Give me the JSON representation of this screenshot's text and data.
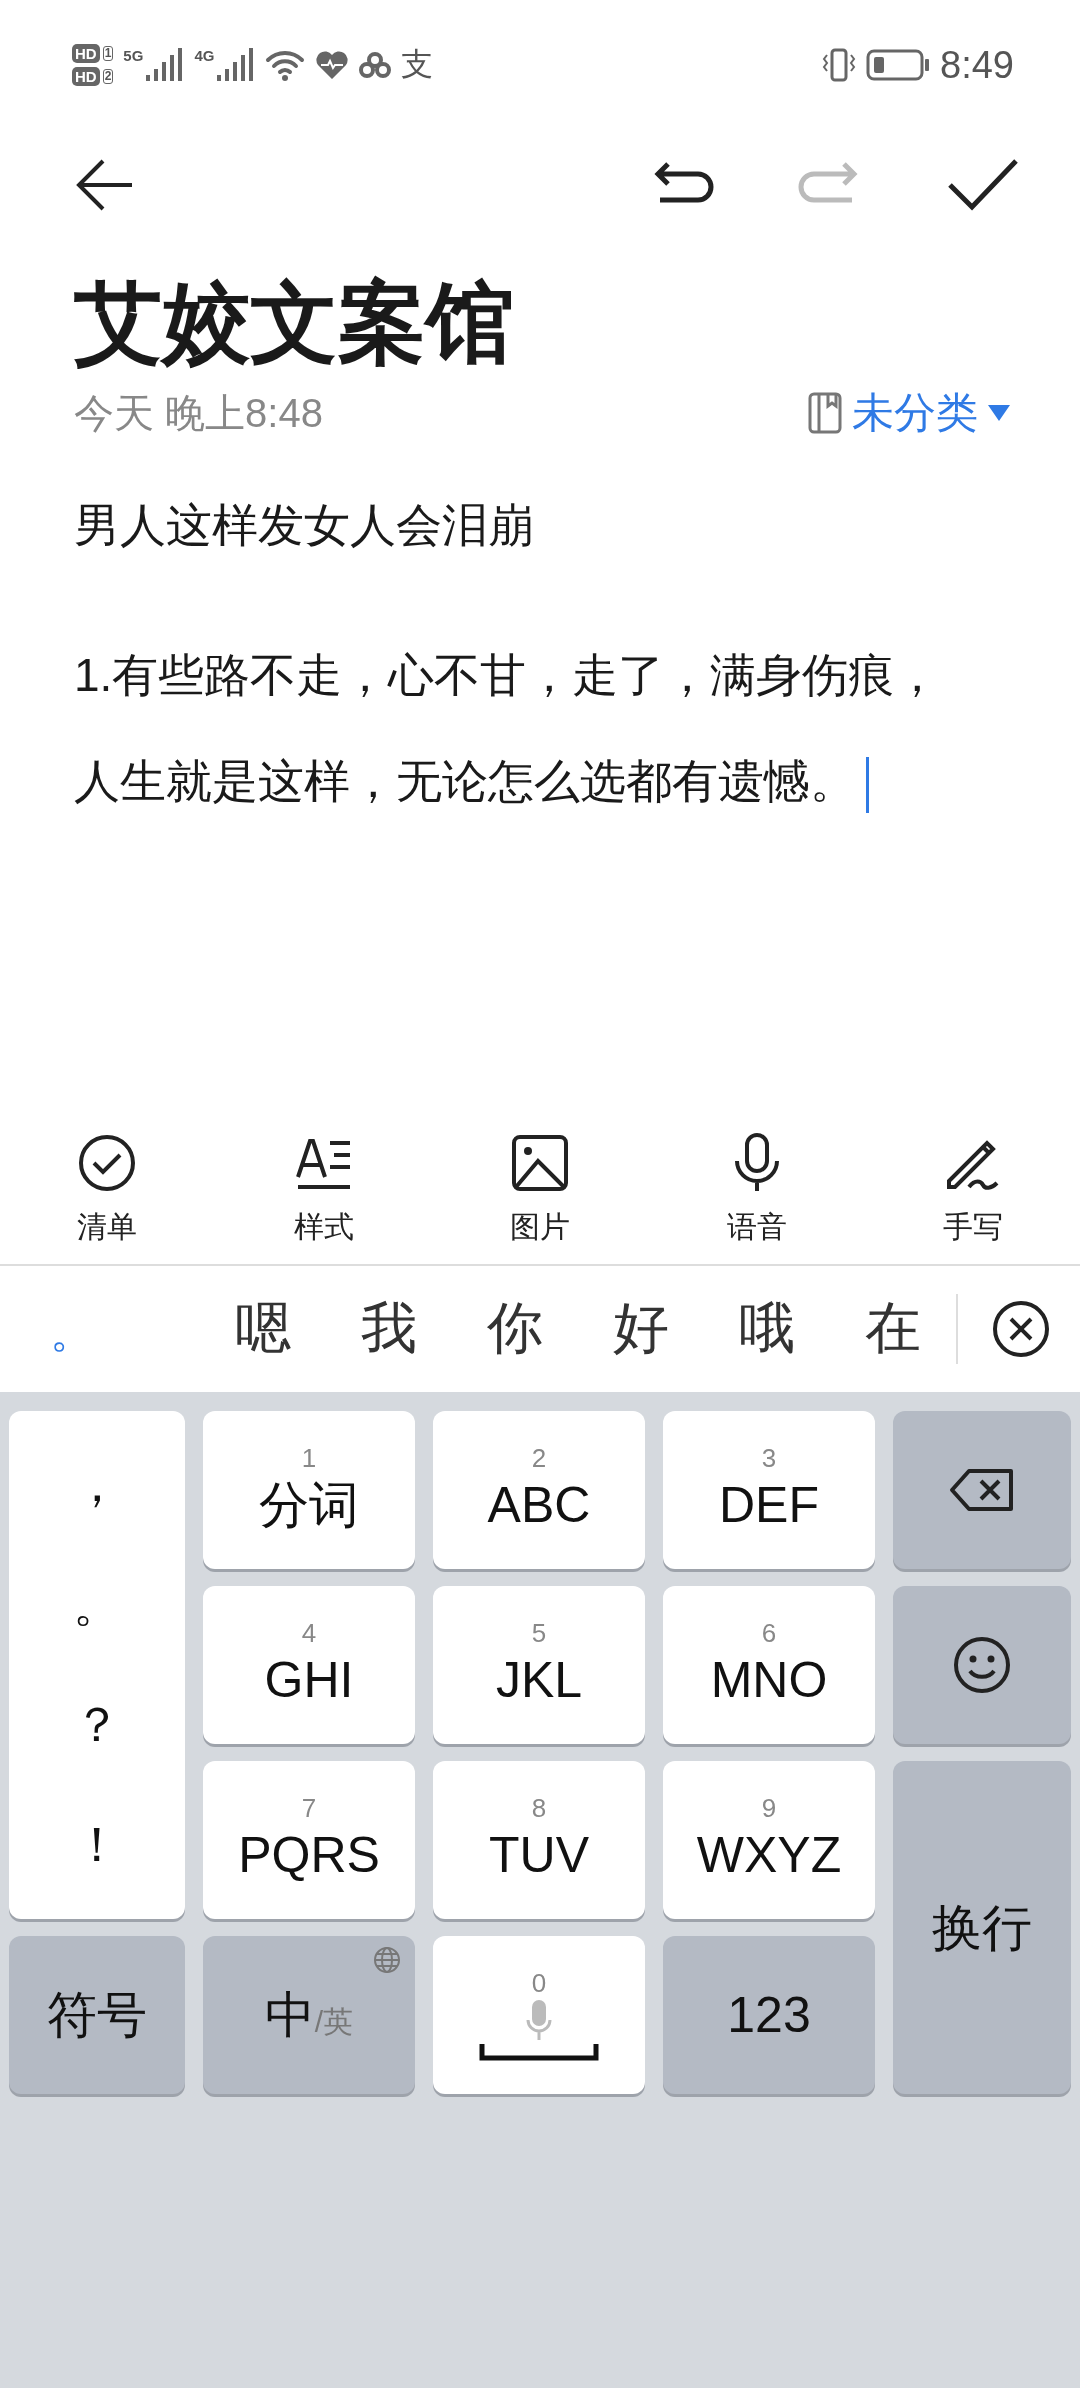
{
  "status_bar": {
    "sims": [
      {
        "badge": "HD",
        "slot": "1"
      },
      {
        "badge": "HD",
        "slot": "2"
      }
    ],
    "networks": [
      {
        "type": "5G"
      },
      {
        "type": "4G"
      }
    ],
    "app_glyph": "支",
    "time": "8:49"
  },
  "nav": {
    "undo": {
      "disabled": false
    },
    "redo": {
      "disabled": true
    }
  },
  "note": {
    "title": "艾姣文案馆",
    "date": "今天 晚上8:48",
    "category": "未分类",
    "paragraphs": [
      {
        "lines": [
          "男人这样发女人会泪崩"
        ]
      },
      {
        "lines": [
          "1.有些路不走，心不甘，走了，满身伤痕，",
          "人生就是这样，无论怎么选都有遗憾。"
        ]
      }
    ],
    "cursor_visible": true
  },
  "toolbar": [
    {
      "kind": "checklist",
      "label": "清单"
    },
    {
      "kind": "style",
      "label": "样式"
    },
    {
      "kind": "image",
      "label": "图片"
    },
    {
      "kind": "voice",
      "label": "语音"
    },
    {
      "kind": "handwriting",
      "label": "手写"
    }
  ],
  "candidates": {
    "composition": "。",
    "words": [
      "嗯",
      "我",
      "你",
      "好",
      "哦",
      "在"
    ]
  },
  "keyboard": [
    {
      "kind": "punct",
      "symbols": [
        "，",
        "。",
        "？",
        "！"
      ]
    },
    {
      "kind": "letter",
      "digit": "1",
      "label": "分词"
    },
    {
      "kind": "letter",
      "digit": "2",
      "label": "ABC"
    },
    {
      "kind": "letter",
      "digit": "3",
      "label": "DEF"
    },
    {
      "kind": "backspace"
    },
    {
      "kind": "letter",
      "digit": "4",
      "label": "GHI"
    },
    {
      "kind": "letter",
      "digit": "5",
      "label": "JKL"
    },
    {
      "kind": "letter",
      "digit": "6",
      "label": "MNO"
    },
    {
      "kind": "emoji"
    },
    {
      "kind": "letter",
      "digit": "7",
      "label": "PQRS"
    },
    {
      "kind": "letter",
      "digit": "8",
      "label": "TUV"
    },
    {
      "kind": "letter",
      "digit": "9",
      "label": "WXYZ"
    },
    {
      "kind": "enter",
      "label": "换行"
    },
    {
      "kind": "symbol",
      "label": "符号"
    },
    {
      "kind": "lang",
      "label": "中",
      "sub": "/英"
    },
    {
      "kind": "space",
      "digit": "0"
    },
    {
      "kind": "number",
      "label": "123"
    }
  ]
}
